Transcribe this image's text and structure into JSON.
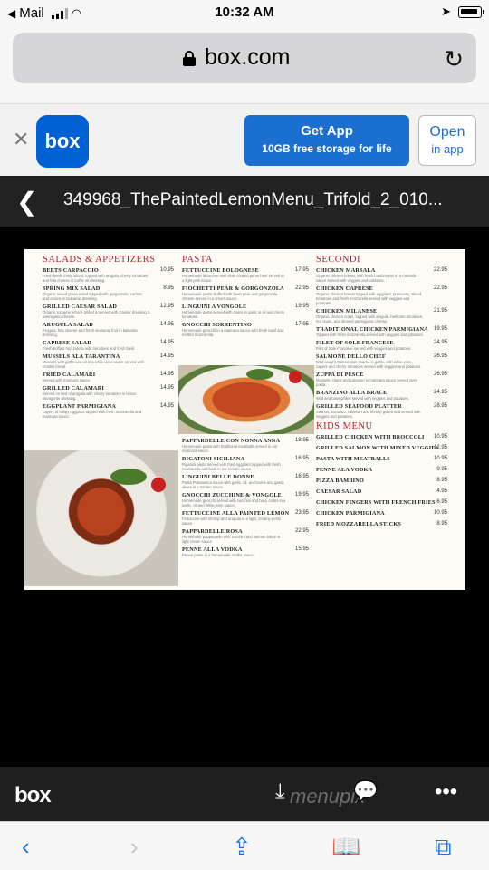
{
  "status_bar": {
    "carrier": "Mail",
    "time": "10:32 AM"
  },
  "browser": {
    "domain": "box.com",
    "reload_icon": "reload-icon"
  },
  "app_banner": {
    "app_logo_text": "box",
    "get_app_title": "Get App",
    "get_app_subtitle": "10GB free storage for life",
    "open_title": "Open",
    "open_subtitle": "in app"
  },
  "file": {
    "name": "349968_ThePaintedLemonMenu_Trifold_2_010..."
  },
  "menu": {
    "col1": {
      "title": "SALADS & APPETIZERS",
      "items": [
        {
          "name": "BEETS CARPACCIO",
          "price": "10.95",
          "desc": "Fresh beets thinly sliced, topped with arugula, cherry tomatoes and feta cheese in truffle oil dressing."
        },
        {
          "name": "SPRING MIX SALAD",
          "price": "8.95",
          "desc": "Organic mixed green salad topped with gorgonzola, carrots, and onions in balsamic dressing."
        },
        {
          "name": "GRILLED CAESAR SALAD",
          "price": "12.95",
          "desc": "Organic romaine lettuce grilled & served with Caesar dressing & parmigiano cheese."
        },
        {
          "name": "ARUGULA SALAD",
          "price": "14.95",
          "desc": "Arugula, feta cheese and fresh seasonal fruit in balsamic dressing."
        },
        {
          "name": "CAPRESE SALAD",
          "price": "14.95",
          "desc": "Fresh buffalo mozzarella with tomatoes and fresh basil."
        },
        {
          "name": "MUSSELS ALA TARANTINA",
          "price": "14.95",
          "desc": "Mussels with garlic and oil in a white wine sauce served with crostini bread."
        },
        {
          "name": "FRIED CALAMARI",
          "price": "14.95",
          "desc": "Served with marinara sauce."
        },
        {
          "name": "GRILLED CALAMARI",
          "price": "14.95",
          "desc": "Served on bed of arugula with cherry tomatoes in lemon vinaigrette dressing."
        },
        {
          "name": "EGGPLANT PARMIGIANA",
          "price": "14.95",
          "desc": "Layers of crispy eggplant topped with fresh mozzarella and marinara sauce."
        }
      ]
    },
    "col2": {
      "title": "PASTA",
      "items_top": [
        {
          "name": "FETTUCCINE BOLOGNESE",
          "price": "17.95",
          "desc": "Homemade fettuccine with slow cooked prime beef served in a light pink sauce."
        },
        {
          "name": "FIOCHETTI PEAR & GORGONZOLA",
          "price": "22.95",
          "desc": "Homemade pasta stuffed with fresh pear and gorgonzola cheese served in a cream sauce."
        },
        {
          "name": "LINGUINI A VONGOLE",
          "price": "19.95",
          "desc": "Homemade pasta served with clams in garlic & oil and cherry tomatoes."
        },
        {
          "name": "GNOCCHI SORRENTINO",
          "price": "17.95",
          "desc": "Homemade gnocchi in a marinara sauce with fresh basil and melted mozzarella."
        }
      ],
      "items_bottom": [
        {
          "name": "PAPPARDELLE CON NONNA ANNA",
          "price": "18.95",
          "desc": "Homemade pasta with traditional meatballs served in our marinara sauce."
        },
        {
          "name": "RIGATONI SICILIANA",
          "price": "16.95",
          "desc": "Rigatoni pasta served with fried eggplant topped with fresh mozzarella and basil in our tomato sauce."
        },
        {
          "name": "LINGUINI BELLE DONNE",
          "price": "16.95",
          "desc": "Pasta Puttanesca sauce with garlic, oil, anchovies and gaeta olives in a tomato sauce."
        },
        {
          "name": "GNOCCHI ZUCCHINE & VONGOLE",
          "price": "19.95",
          "desc": "Homemade gnocchi served with zucchini and baby clams in a garlic, oil and white wine sauce."
        },
        {
          "name": "FETTUCCINE ALLA PAINTED LEMON",
          "price": "23.95",
          "desc": "Fettuccine with shrimp and arugula in a light, creamy pesto sauce."
        },
        {
          "name": "PAPPARDELLE ROSA",
          "price": "22.95",
          "desc": "Homemade pappardelle with zucchini and salmon bits in a light cream sauce."
        },
        {
          "name": "PENNE ALLA VODKA",
          "price": "15.95",
          "desc": "Penne pasta in a homemade Vodka sauce."
        }
      ]
    },
    "col3": {
      "title": "SECONDI",
      "items": [
        {
          "name": "CHICKEN MARSALA",
          "price": "22.95",
          "desc": "Organic chicken breast, with fresh mushrooms in a marsala sauce served with veggies and potatoes."
        },
        {
          "name": "CHICKEN CAPRESE",
          "price": "22.95",
          "desc": "Organic chicken breast topped with eggplant, prosciutto, sliced tomatoes and fresh mozzarella served with veggies and potatoes."
        },
        {
          "name": "CHICKEN MILANESE",
          "price": "21.95",
          "desc": "Organic chicken cutlet, topped with arugula, heirloom tomatoes, red onion, and shaved parmigiana cheese."
        },
        {
          "name": "TRADITIONAL CHICKEN PARMIGIANA",
          "price": "19.95",
          "desc": "Topped with fresh mozzarella served with veggies and potatoes."
        },
        {
          "name": "FILET OF SOLE FRANCESE",
          "price": "24.95",
          "desc": "Filet of Sole Francese served with veggies and potatoes."
        },
        {
          "name": "SALMONE DELLO CHEF",
          "price": "26.95",
          "desc": "Wild caught Salmon pan seared in garlic, with white wine, capers and cherry tomatoes served with veggies and potatoes."
        },
        {
          "name": "ZUPPA DI PESCE",
          "price": "26.95",
          "desc": "Mussels, clams and calamari in marinara sauce served over pasta."
        },
        {
          "name": "BRANZINO ALLA BRACE",
          "price": "24.95",
          "desc": "Wild sea bass grilled served with veggies and potatoes."
        },
        {
          "name": "GRILLED SEAFOOD PLATTER",
          "price": "28.95",
          "desc": "Salmon, branzino, calamari and shrimp grilled and served with veggies and potatoes."
        }
      ],
      "kids_title": "KIDS MENU",
      "kids": [
        {
          "name": "GRILLED CHICKEN WITH BROCCOLI",
          "price": "10.95"
        },
        {
          "name": "GRILLED SALMON WITH MIXED VEGGIES",
          "price": "12.95"
        },
        {
          "name": "PASTA WITH MEATBALLS",
          "price": "10.95"
        },
        {
          "name": "PENNE ALA VODKA",
          "price": "9.95"
        },
        {
          "name": "PIZZA BAMBINO",
          "price": "8.95"
        },
        {
          "name": "CAESAR SALAD",
          "price": "4.95"
        },
        {
          "name": "CHICKEN FINGERS WITH FRENCH FRIES",
          "price": "6.95"
        },
        {
          "name": "CHICKEN PARMIGIANA",
          "price": "10.95"
        },
        {
          "name": "FRIED MOZZARELLA STICKS",
          "price": "8.95"
        }
      ]
    }
  },
  "box_bar": {
    "logo": "box",
    "watermark": "menupix"
  },
  "colors": {
    "accent": "#1a73e8",
    "menu_red": "#b3202a",
    "box_blue": "#0061d5"
  }
}
